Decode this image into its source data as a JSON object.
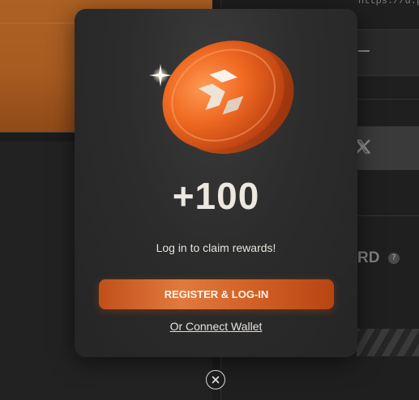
{
  "background": {
    "url_fragment": "https://d.p.",
    "field_value": "--",
    "x_icon": "x-logo-icon",
    "section_fragment": "RD",
    "help_icon_label": "?"
  },
  "modal": {
    "amount": "+100",
    "subtitle": "Log in to claim rewards!",
    "register_label": "REGISTER & LOG-IN",
    "connect_label": "Or Connect Wallet",
    "coin_icon": "coin-logo-icon",
    "close_icon": "close-icon"
  },
  "colors": {
    "accent": "#d9662a",
    "modal_bg": "#2c2c2c",
    "text": "#e6e2dc"
  }
}
